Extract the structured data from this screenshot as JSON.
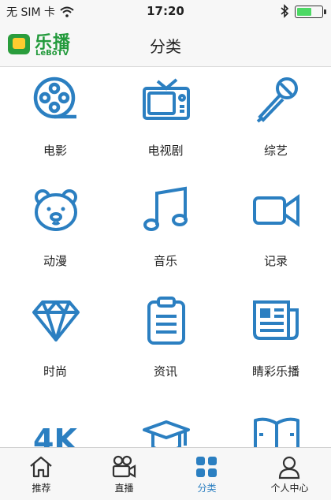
{
  "status_bar": {
    "carrier": "无 SIM 卡",
    "time": "17:20"
  },
  "nav": {
    "logo_cn": "乐播",
    "logo_en": "LeBoTV",
    "title": "分类"
  },
  "categories": [
    {
      "label": "电影",
      "icon": "film-reel-icon"
    },
    {
      "label": "电视剧",
      "icon": "tv-icon"
    },
    {
      "label": "综艺",
      "icon": "microphone-icon"
    },
    {
      "label": "动漫",
      "icon": "bear-face-icon"
    },
    {
      "label": "音乐",
      "icon": "music-note-icon"
    },
    {
      "label": "记录",
      "icon": "video-camera-icon"
    },
    {
      "label": "时尚",
      "icon": "diamond-icon"
    },
    {
      "label": "资讯",
      "icon": "clipboard-icon"
    },
    {
      "label": "睛彩乐播",
      "icon": "newspaper-icon"
    },
    {
      "label": "",
      "icon": "4k-icon",
      "icon_text": "4K"
    },
    {
      "label": "",
      "icon": "graduation-cap-icon"
    },
    {
      "label": "",
      "icon": "open-book-icon"
    }
  ],
  "tabbar": {
    "tabs": [
      {
        "label": "推荐",
        "icon": "home-icon",
        "active": false
      },
      {
        "label": "直播",
        "icon": "live-camera-icon",
        "active": false
      },
      {
        "label": "分类",
        "icon": "grid-icon",
        "active": true
      },
      {
        "label": "个人中心",
        "icon": "person-icon",
        "active": false
      }
    ]
  },
  "colors": {
    "accent": "#2b7fc1",
    "logo_green": "#239a3c",
    "logo_yellow": "#ffcc2f",
    "battery": "#4cd964"
  }
}
